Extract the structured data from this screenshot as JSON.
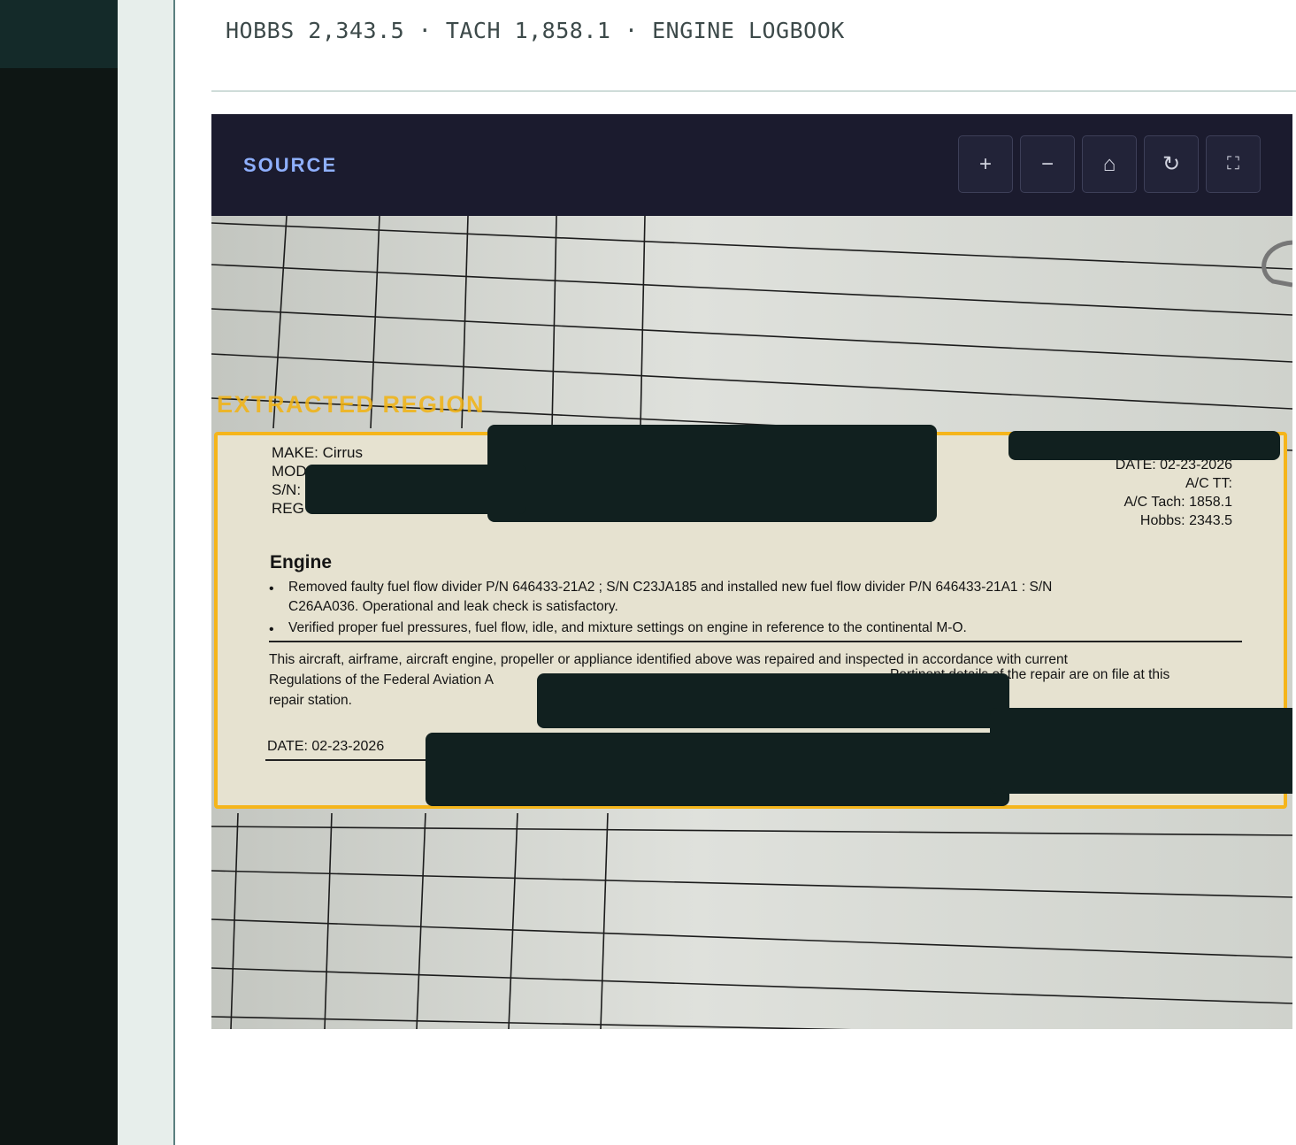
{
  "header": {
    "meta_line": "HOBBS 2,343.5 · TACH 1,858.1 · ENGINE LOGBOOK"
  },
  "viewer": {
    "title": "SOURCE",
    "tools": [
      {
        "icon": "zoom-in-icon",
        "glyph": "+"
      },
      {
        "icon": "zoom-out-icon",
        "glyph": "−"
      },
      {
        "icon": "home-icon",
        "glyph": "⌂"
      },
      {
        "icon": "rotate-icon",
        "glyph": "↻"
      },
      {
        "icon": "fullscreen-icon",
        "glyph": "⛶"
      }
    ],
    "region_label": "EXTRACTED REGION"
  },
  "document": {
    "make": "MAKE: Cirrus",
    "model_prefix": "MOD",
    "sn_prefix": "S/N:",
    "reg_prefix": "REG",
    "date_top": "DATE: 02-23-2026",
    "ac_tt": "A/C TT:",
    "ac_tach": "A/C Tach: 1858.1",
    "hobbs": "Hobbs: 2343.5",
    "section": "Engine",
    "bullet1_line1": "Removed faulty fuel flow divider P/N 646433-21A2 ; S/N C23JA185 and installed new fuel flow divider P/N 646433-21A1 : S/N",
    "bullet1_line2": "C26AA036. Operational and leak check is satisfactory.",
    "bullet2": "Verified proper fuel pressures, fuel flow, idle, and mixture settings on engine in reference to the continental M-O.",
    "cert_line1": "This aircraft, airframe, aircraft engine, propeller or appliance identified above was repaired and inspected in accordance with current",
    "cert_line2": "Regulations of the Federal Aviation A",
    "cert_line2b": "Pertinent details of the repair are on file at this",
    "cert_line3": "repair station.",
    "date_bottom": "DATE: 02-23-2026"
  }
}
